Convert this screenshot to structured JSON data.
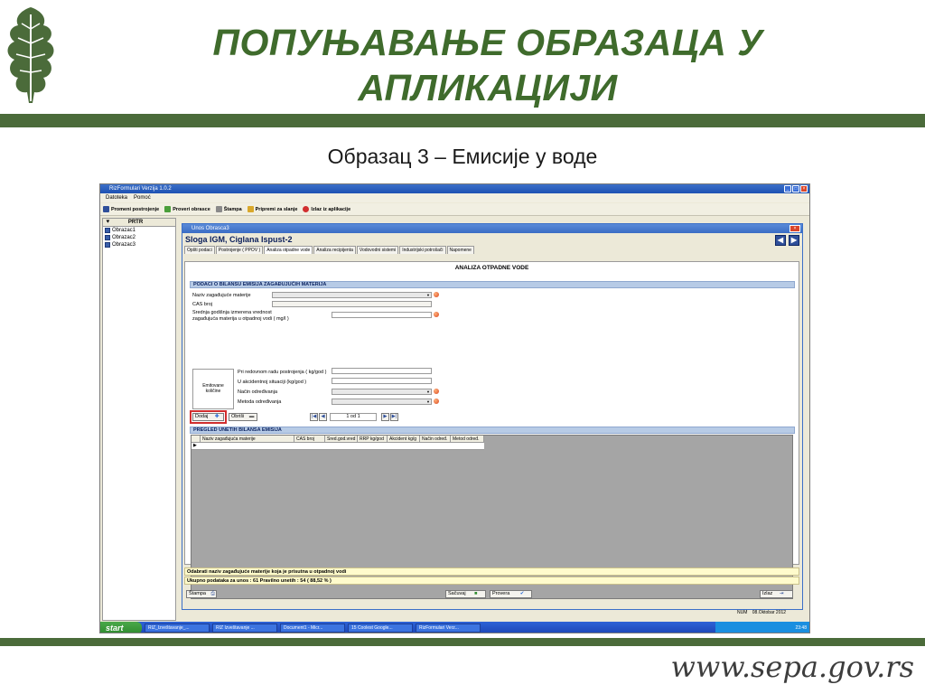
{
  "slide": {
    "title_line1": "ПОПУЊАВАЊЕ ОБРАЗАЦА У",
    "title_line2": "АПЛИКАЦИЈИ",
    "subtitle": "Образац 3 – Емисије у воде",
    "url": "www.sepa.gov.rs",
    "colors": {
      "title": "#3f6b2c",
      "bar": "#4b6b3a"
    }
  },
  "app": {
    "window_title": "RizFormulari Verzija 1.0.2",
    "menu": [
      "Datoteka",
      "Pomoć"
    ],
    "toolbar": [
      "Promeni postrojenje",
      "Proveri obrasce",
      "Štampa",
      "Pripremi za slanje",
      "Izlaz iz aplikacije"
    ],
    "leftnav": {
      "header": "PRTR",
      "items": [
        "Obrazac1",
        "Obrazac2",
        "Obrazac3"
      ]
    }
  },
  "form": {
    "window_title": "Unos Obrasca3",
    "record_title": "Sloga IGM, Ciglana   Ispust-2",
    "tabs": [
      "Opšti podaci",
      "Postrojenje ( PPOV )",
      "Analiza otpadne vode",
      "Analiza recipijenta",
      "Vodovodni sistemi",
      "Industrijski potrošači",
      "Napomene"
    ],
    "active_tab": 2,
    "heading": "ANALIZA OTPADNE VODE",
    "section1": "PODACI O BILANSU EMISIJA ZAGAĐUJUĆIH MATERIJA",
    "fields": {
      "naziv": "Naziv zagađujuće materije",
      "cas": "CAS broj",
      "srednja_line1": "Srednja godišnja izmerena vrednost",
      "srednja_line2": "zagađujuća materija u otpadnoj vodi ( mg/l )",
      "emit_box_line1": "Emitovane",
      "emit_box_line2": "količine",
      "redovan": "Pri redovnom radu postrojenja ( kg/god )",
      "akcident": "U akcidentnoj situaciji (kg/god )",
      "nacin": "Način određivanja",
      "metoda": "Metoda određivanja"
    },
    "buttons": {
      "add": "Dodaj",
      "delete": "Obriši"
    },
    "pager": "1 od 1",
    "section2": "PREGLED UNETIH BILANSA EMISIJA",
    "grid_columns": [
      "Naziv zagađujuća materije",
      "CAS broj",
      "Sred.god.vred",
      "RRP kg/god",
      "Akcident kg/g",
      "Način određ.",
      "Metod određ."
    ],
    "hint": "Odabrati naziv zagađujuće materije koja je prisutna u otpadnoj vodi",
    "total": "Ukupno podataka za unos : 61 Pravilno unetih : 54  ( 88,52 % )",
    "bottom_buttons": {
      "print": "Štampa",
      "save": "Sačuvaj",
      "check": "Provera",
      "exit": "Izlaz"
    }
  },
  "statusbar": {
    "num": "NUM",
    "date": "08.Oktobar 2012"
  },
  "taskbar": {
    "start": "start",
    "tasks": [
      "RIZ_Izveštavanje_...",
      "RIZ Izveštavanje ...",
      "Document1 - Micr...",
      "15 Coolest Google...",
      "RizFormulari Verz..."
    ],
    "clock": "23:48"
  }
}
